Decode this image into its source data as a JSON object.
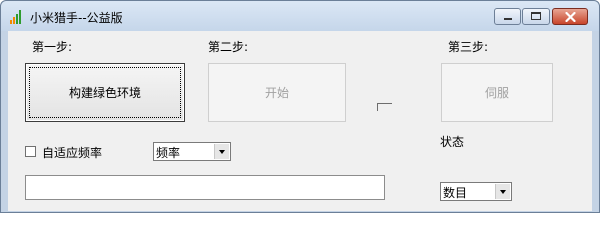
{
  "window": {
    "title": "小米猎手--公益版"
  },
  "steps": {
    "step1": "第一步:",
    "step2": "第二步:",
    "step3": "第三步:"
  },
  "buttons": {
    "build_env": "构建绿色环境",
    "start": "开始",
    "servo": "伺服"
  },
  "options": {
    "adaptive_frequency_label": "自适应频率",
    "adaptive_frequency_checked": false
  },
  "frequency_select": {
    "selected": "频率"
  },
  "status": {
    "label": "状态"
  },
  "count_select": {
    "selected": "数目"
  },
  "input": {
    "value": ""
  },
  "colors": {
    "client_bg": "#f0f0f0",
    "close_button": "#c8452b",
    "icon_green": "#2e9c2e",
    "icon_orange": "#f08a00"
  }
}
